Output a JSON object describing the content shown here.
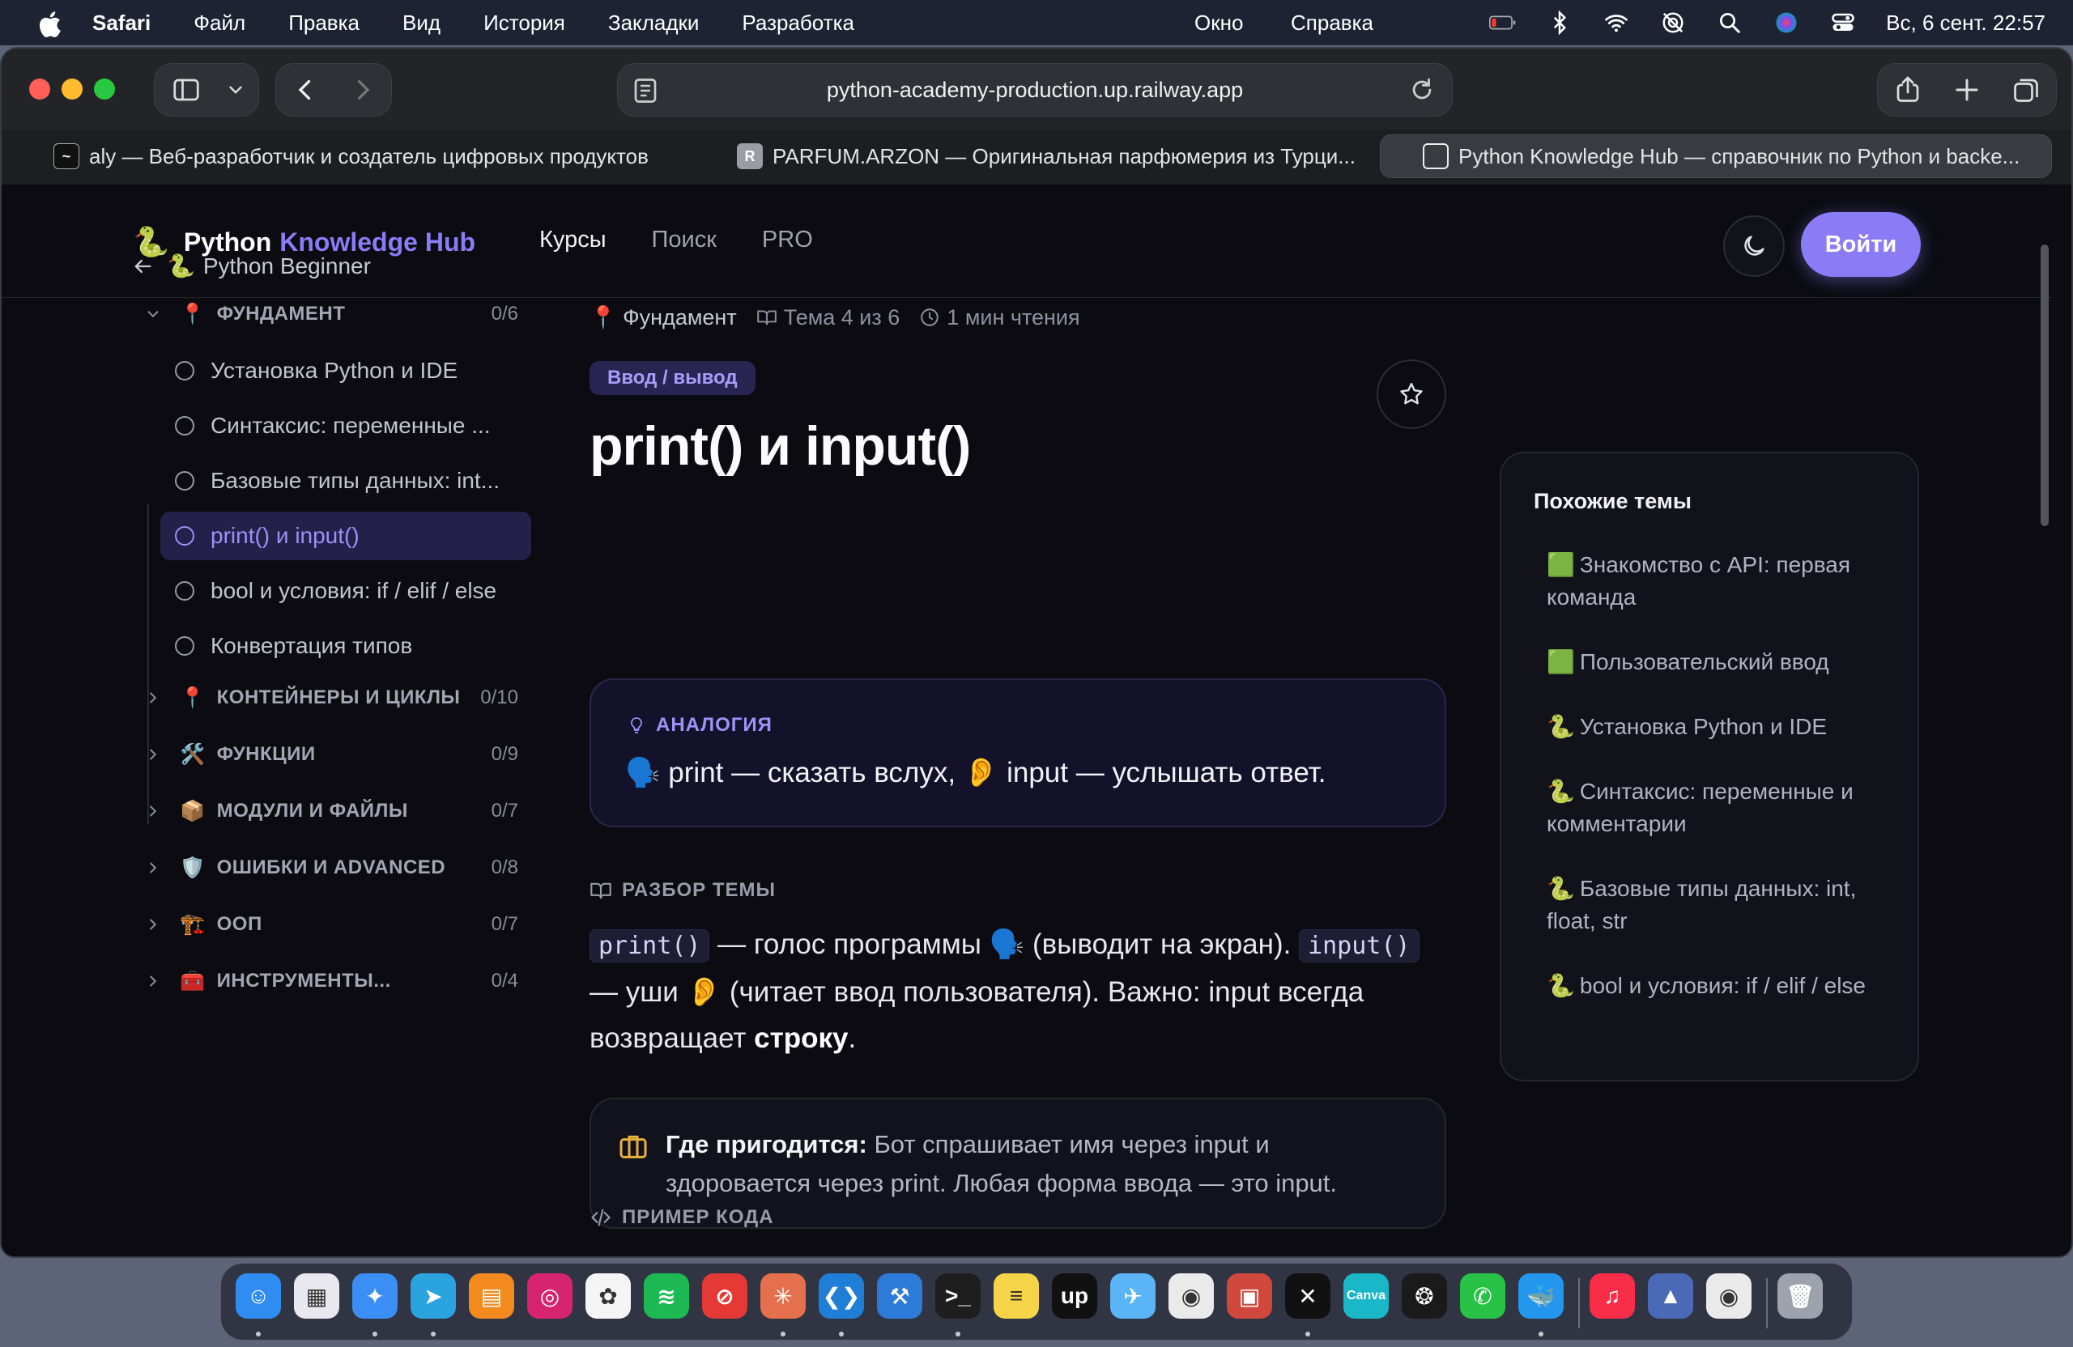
{
  "menubar": {
    "app": "Safari",
    "items": [
      "Файл",
      "Правка",
      "Вид",
      "История",
      "Закладки",
      "Разработка",
      "Окно",
      "Справка"
    ],
    "datetime": "Вс, 6 сент.  22:57"
  },
  "browser": {
    "url": "python-academy-production.up.railway.app",
    "tabs": [
      {
        "label": "aly — Веб-разработчик и создатель цифровых продуктов",
        "favicon": "~"
      },
      {
        "label": "PARFUM.ARZON — Оригинальная парфюмерия из Турци...",
        "favicon": "R"
      },
      {
        "label": "Python Knowledge Hub — справочник по Python и backe...",
        "favicon": ""
      }
    ]
  },
  "site": {
    "logo_emoji": "🐍",
    "logo_part1": "Python",
    "logo_part2": "Knowledge Hub",
    "nav": [
      "Курсы",
      "Поиск",
      "PRO"
    ],
    "login": "Войти",
    "accent": "#8b7cf6"
  },
  "sidebar": {
    "back_emoji": "🐍",
    "back_label": "Python Beginner",
    "sections": [
      {
        "emoji": "📍",
        "title": "ФУНДАМЕНТ",
        "count": "0/6"
      },
      {
        "emoji": "📍",
        "title": "КОНТЕЙНЕРЫ И ЦИКЛЫ",
        "count": "0/10"
      },
      {
        "emoji": "🛠️",
        "title": "ФУНКЦИИ",
        "count": "0/9"
      },
      {
        "emoji": "📦",
        "title": "МОДУЛИ И ФАЙЛЫ",
        "count": "0/7"
      },
      {
        "emoji": "🛡️",
        "title": "ОШИБКИ И ADVANCED",
        "count": "0/8"
      },
      {
        "emoji": "🏗️",
        "title": "ООП",
        "count": "0/7"
      },
      {
        "emoji": "🧰",
        "title": "ИНСТРУМЕНТЫ...",
        "count": "0/4"
      }
    ],
    "lessons": [
      "Установка Python и IDE",
      "Синтаксис: переменные ...",
      "Базовые типы данных: int...",
      "print() и input()",
      "bool и условия: if / elif / else",
      "Конвертация типов"
    ]
  },
  "lesson": {
    "section_emoji": "📍",
    "section": "Фундамент",
    "topic": "Тема 4 из 6",
    "reading": "1 мин чтения",
    "tag": "Ввод / вывод",
    "title": "print() и input()",
    "analogy_label": "АНАЛОГИЯ",
    "analogy_text": "🗣️ print — сказать вслух,  👂 input — услышать ответ.",
    "breakdown_label": "РАЗБОР ТЕМЫ",
    "code1": "print()",
    "para1": " — голос программы 🗣️ (выводит на экран). ",
    "code2": "input()",
    "para2": " — уши 👂 (читает ввод пользователя). Важно: input всегда возвращает ",
    "para_bold": "строку",
    "para_end": ".",
    "where_label": "Где пригодится:",
    "where_text": " Бот спрашивает имя через input и здоровается через print. Любая форма ввода — это input.",
    "code_example_label": "ПРИМЕР КОДА"
  },
  "related": {
    "title": "Похожие темы",
    "items": [
      {
        "emoji": "🟩",
        "text": "Знакомство с API: первая команда"
      },
      {
        "emoji": "🟩",
        "text": "Пользовательский ввод"
      },
      {
        "emoji": "🐍",
        "text": "Установка Python и IDE"
      },
      {
        "emoji": "🐍",
        "text": "Синтаксис: переменные и комментарии"
      },
      {
        "emoji": "🐍",
        "text": "Базовые типы данных: int, float, str"
      },
      {
        "emoji": "🐍",
        "text": "bool и условия: if / elif / else"
      }
    ]
  },
  "dock": {
    "apps": [
      {
        "name": "finder",
        "glyph": "☺",
        "color": "#2f8cf0"
      },
      {
        "name": "launchpad",
        "glyph": "▦",
        "color": "#e8e8ee"
      },
      {
        "name": "safari",
        "glyph": "✦",
        "color": "#3a8ef6"
      },
      {
        "name": "telegram",
        "glyph": "➤",
        "color": "#2aa3df"
      },
      {
        "name": "books",
        "glyph": "▤",
        "color": "#f28a1e"
      },
      {
        "name": "instagram",
        "glyph": "◎",
        "color": "#d6246e"
      },
      {
        "name": "photos",
        "glyph": "✿",
        "color": "#f5f5f5"
      },
      {
        "name": "spotify",
        "glyph": "≋",
        "color": "#1db954"
      },
      {
        "name": "app-red",
        "glyph": "⊘",
        "color": "#e53935"
      },
      {
        "name": "claude",
        "glyph": "✳",
        "color": "#e4704d"
      },
      {
        "name": "vscode",
        "glyph": "❮❯",
        "color": "#1f7fd6"
      },
      {
        "name": "xcode",
        "glyph": "⚒",
        "color": "#2d7bd8"
      },
      {
        "name": "terminal",
        "glyph": ">_",
        "color": "#1e1e1e"
      },
      {
        "name": "notes",
        "glyph": "≡",
        "color": "#f6d44a"
      },
      {
        "name": "upwork",
        "glyph": "up",
        "color": "#111111"
      },
      {
        "name": "testflight",
        "glyph": "✈",
        "color": "#5ab4f5"
      },
      {
        "name": "chrome",
        "glyph": "◉",
        "color": "#eaeaea"
      },
      {
        "name": "app-archive",
        "glyph": "▣",
        "color": "#d0473c"
      },
      {
        "name": "capcut",
        "glyph": "✕",
        "color": "#111111"
      },
      {
        "name": "canva",
        "glyph": "Canva",
        "color": "#19b7c8"
      },
      {
        "name": "chatgpt",
        "glyph": "❂",
        "color": "#1a1a1a"
      },
      {
        "name": "whatsapp",
        "glyph": "✆",
        "color": "#28c246"
      },
      {
        "name": "docker",
        "glyph": "🐳",
        "color": "#2396ed"
      },
      {
        "name": "music",
        "glyph": "♫",
        "color": "#fa2d48"
      },
      {
        "name": "app-blue",
        "glyph": "▲",
        "color": "#4a6ab8"
      },
      {
        "name": "chrome-2",
        "glyph": "◉",
        "color": "#eaeaea"
      },
      {
        "name": "trash",
        "glyph": "🗑",
        "color": "#9ea2ad"
      }
    ]
  }
}
